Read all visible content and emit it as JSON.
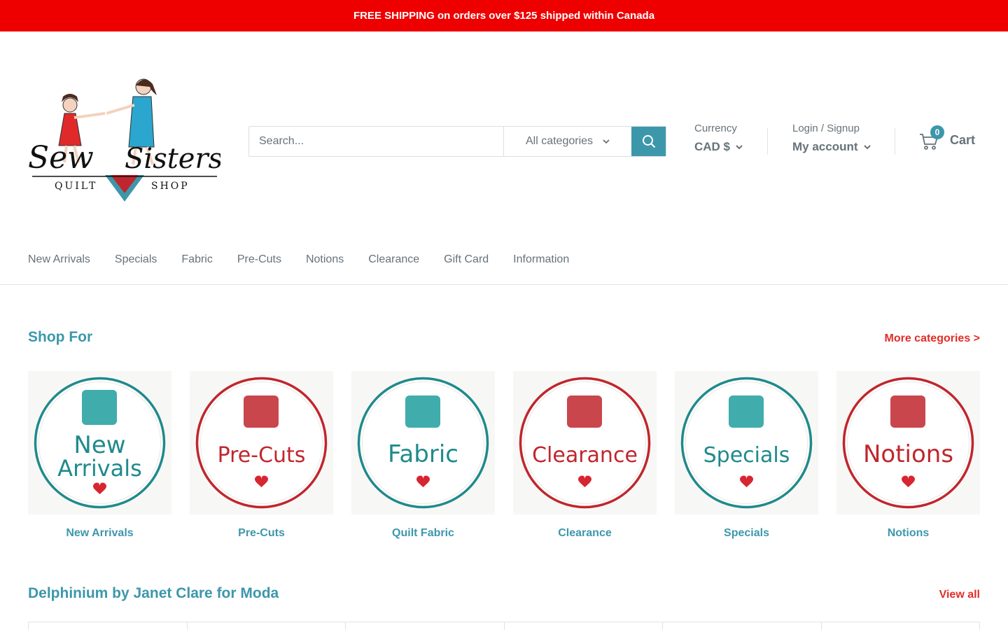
{
  "announcement": "FREE SHIPPING on orders over $125 shipped within Canada",
  "logo": {
    "name": "Sew Sisters",
    "sub_left": "QUILT",
    "sub_right": "SHOP"
  },
  "search": {
    "placeholder": "Search...",
    "category": "All categories"
  },
  "currency": {
    "label": "Currency",
    "value": "CAD $"
  },
  "account": {
    "label": "Login / Signup",
    "value": "My account"
  },
  "cart": {
    "count": "0",
    "label": "Cart"
  },
  "nav": [
    "New Arrivals",
    "Specials",
    "Fabric",
    "Pre-Cuts",
    "Notions",
    "Clearance",
    "Gift Card",
    "Information"
  ],
  "shop_for": {
    "title": "Shop For",
    "link": "More categories >",
    "items": [
      {
        "label": "New Arrivals",
        "badge_line1": "New",
        "badge_line2": "Arrivals",
        "ring": "#1f8a8c",
        "text_color": "#1f8a8c"
      },
      {
        "label": "Pre-Cuts",
        "badge_line1": "Pre-Cuts",
        "badge_line2": "",
        "ring": "#c0262d",
        "text_color": "#c0262d"
      },
      {
        "label": "Quilt Fabric",
        "badge_line1": "Fabric",
        "badge_line2": "",
        "ring": "#1f8a8c",
        "text_color": "#1f8a8c"
      },
      {
        "label": "Clearance",
        "badge_line1": "Clearance",
        "badge_line2": "",
        "ring": "#c0262d",
        "text_color": "#c0262d"
      },
      {
        "label": "Specials",
        "badge_line1": "Specials",
        "badge_line2": "",
        "ring": "#1f8a8c",
        "text_color": "#1f8a8c"
      },
      {
        "label": "Notions",
        "badge_line1": "Notions",
        "badge_line2": "",
        "ring": "#c0262d",
        "text_color": "#c0262d"
      }
    ]
  },
  "collection": {
    "title": "Delphinium by Janet Clare for Moda",
    "link": "View all"
  },
  "colors": {
    "announcement_bg": "#ee0000",
    "accent": "#3d97ab",
    "link_red": "#e22d28",
    "text": "#677279"
  }
}
